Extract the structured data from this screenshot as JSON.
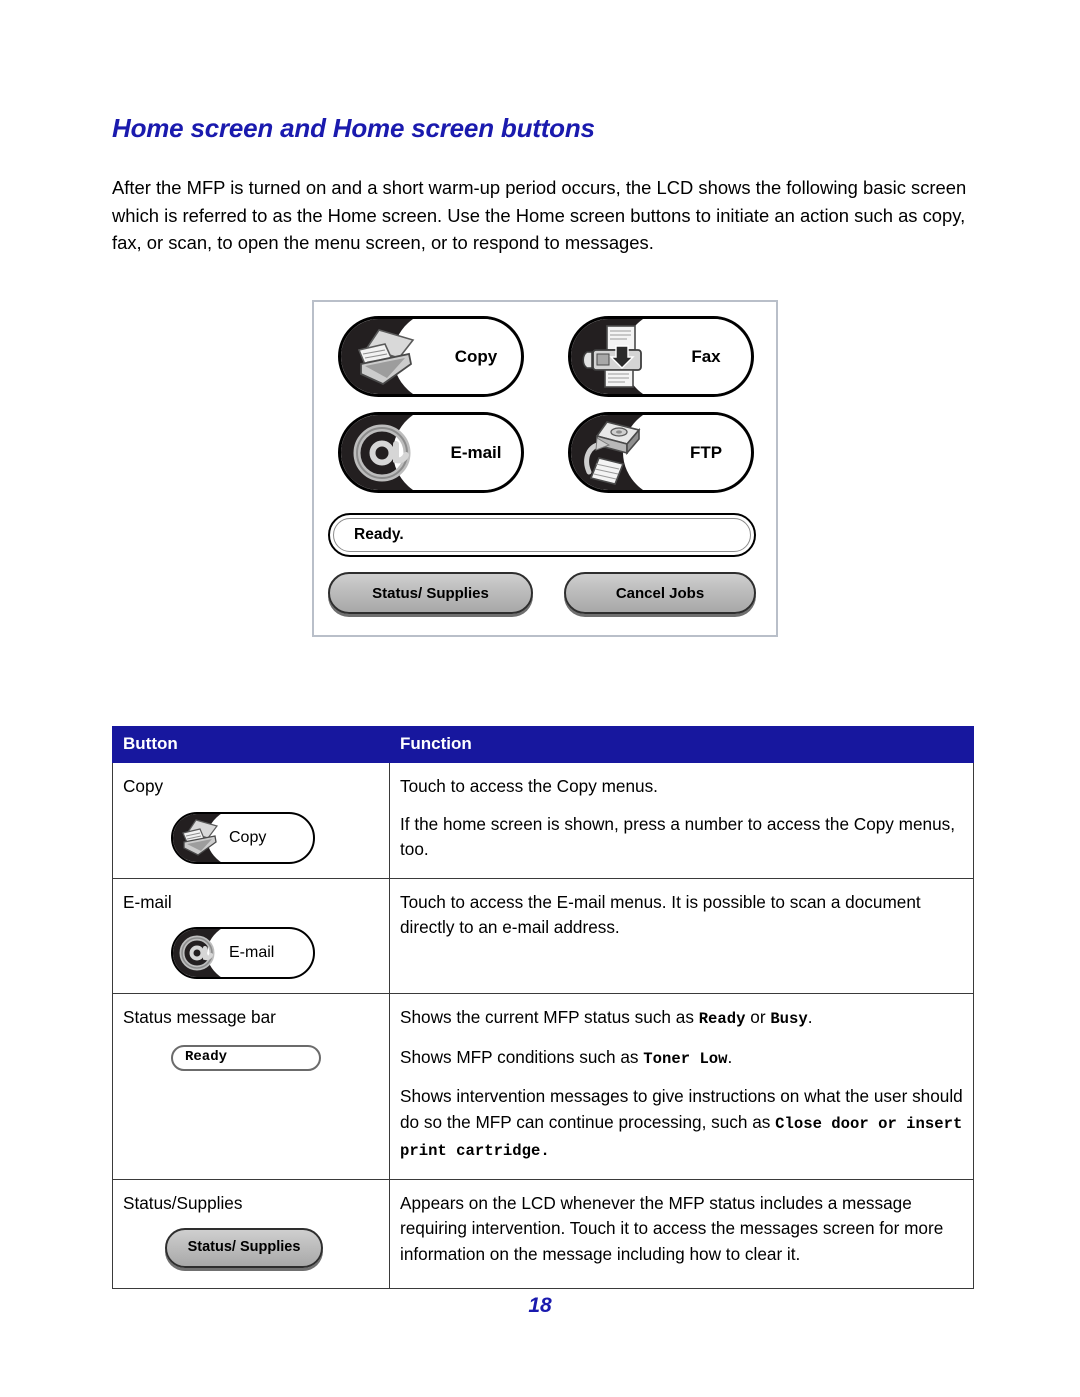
{
  "document": {
    "heading": "Home screen and Home screen buttons",
    "intro": "After the MFP is turned on and a short warm-up period occurs, the LCD shows the following basic screen which is referred to as the Home screen. Use the Home screen buttons to initiate an action such as copy, fax, or scan, to open the menu screen, or to respond to messages.",
    "page_number": "18"
  },
  "colors": {
    "heading_blue": "#1a1aae",
    "table_header_blue": "#17179e",
    "button_black": "#231f20",
    "gray_button": "#bcbcbc",
    "lcd_frame_border": "#b9bfc9"
  },
  "lcd_screen": {
    "buttons": [
      {
        "label": "Copy",
        "icon": "scanner-copy-icon"
      },
      {
        "label": "Fax",
        "icon": "fax-machine-icon"
      },
      {
        "label": "E-mail",
        "icon": "at-sign-icon"
      },
      {
        "label": "FTP",
        "icon": "disk-drive-transfer-icon"
      }
    ],
    "status_message": "Ready.",
    "action_buttons": [
      {
        "label": "Status/ Supplies"
      },
      {
        "label": "Cancel Jobs"
      }
    ]
  },
  "table": {
    "headers": {
      "button": "Button",
      "function": "Function"
    },
    "rows": [
      {
        "name": "Copy",
        "graphic": {
          "type": "mini-button",
          "label": "Copy",
          "icon": "scanner-copy-icon"
        },
        "function_paragraphs": [
          {
            "parts": [
              {
                "text": "Touch to access the Copy menus.",
                "style": "normal"
              }
            ]
          },
          {
            "parts": [
              {
                "text": "If the home screen is shown, press a number to access the Copy menus, too.",
                "style": "normal"
              }
            ]
          }
        ]
      },
      {
        "name": "E-mail",
        "graphic": {
          "type": "mini-button",
          "label": "E-mail",
          "icon": "at-sign-icon"
        },
        "function_paragraphs": [
          {
            "parts": [
              {
                "text": "Touch to access the E-mail menus. It is possible to scan a document directly to an e-mail address.",
                "style": "normal"
              }
            ]
          }
        ]
      },
      {
        "name": "Status message bar",
        "graphic": {
          "type": "ready-pill",
          "label": "Ready"
        },
        "function_paragraphs": [
          {
            "parts": [
              {
                "text": "Shows the current MFP status such as ",
                "style": "normal"
              },
              {
                "text": "Ready",
                "style": "mono"
              },
              {
                "text": " or ",
                "style": "normal"
              },
              {
                "text": "Busy",
                "style": "mono"
              },
              {
                "text": ".",
                "style": "normal"
              }
            ]
          },
          {
            "parts": [
              {
                "text": "Shows MFP conditions such as ",
                "style": "normal"
              },
              {
                "text": "Toner Low",
                "style": "mono"
              },
              {
                "text": ".",
                "style": "normal"
              }
            ]
          },
          {
            "parts": [
              {
                "text": "Shows intervention messages to give instructions on what the user should do so the MFP can continue processing, such as ",
                "style": "normal"
              },
              {
                "text": "Close door or insert print cartridge.",
                "style": "mono"
              }
            ]
          }
        ]
      },
      {
        "name": "Status/Supplies",
        "graphic": {
          "type": "gray-button",
          "label": "Status/ Supplies"
        },
        "function_paragraphs": [
          {
            "parts": [
              {
                "text": "Appears on the LCD whenever the MFP status includes a message requiring intervention. Touch it to access the messages screen for more information on the message including how to clear it.",
                "style": "normal"
              }
            ]
          }
        ]
      }
    ]
  }
}
